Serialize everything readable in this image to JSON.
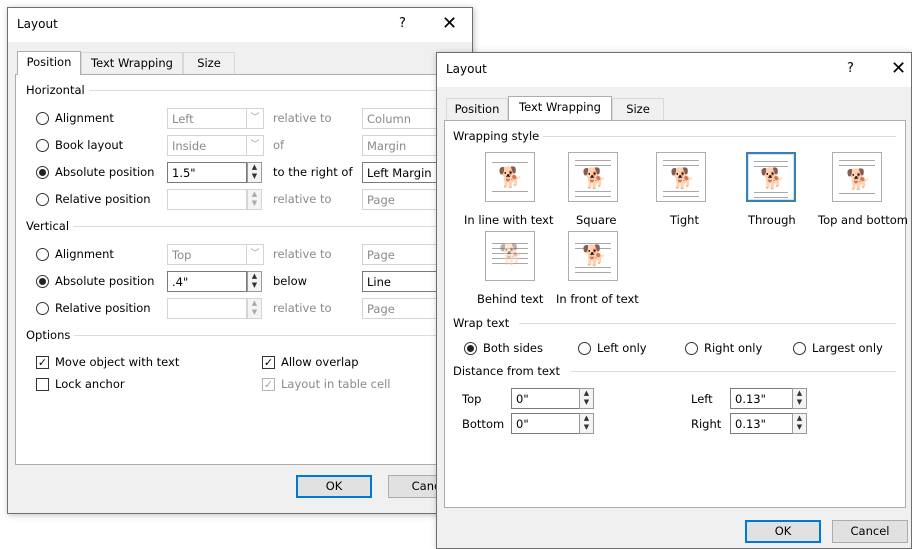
{
  "back_dialog": {
    "title": "Layout",
    "help": "?",
    "close": "✕",
    "tabs": [
      "Position",
      "Text Wrapping",
      "Size"
    ],
    "horizontal": {
      "label": "Horizontal",
      "rows": [
        {
          "label": "Alignment",
          "value": "Left",
          "rel": "relative to",
          "target": "Column"
        },
        {
          "label": "Book layout",
          "value": "Inside",
          "rel": "of",
          "target": "Margin"
        },
        {
          "label": "Absolute position",
          "value": "1.5\"",
          "rel": "to the right of",
          "target": "Left Margin"
        },
        {
          "label": "Relative position",
          "value": "",
          "rel": "relative to",
          "target": "Page"
        }
      ]
    },
    "vertical": {
      "label": "Vertical",
      "rows": [
        {
          "label": "Alignment",
          "value": "Top",
          "rel": "relative to",
          "target": "Page"
        },
        {
          "label": "Absolute position",
          "value": ".4\"",
          "rel": "below",
          "target": "Line"
        },
        {
          "label": "Relative position",
          "value": "",
          "rel": "relative to",
          "target": "Page"
        }
      ]
    },
    "options": {
      "label": "Options",
      "move_with_text": "Move object with text",
      "lock_anchor": "Lock anchor",
      "allow_overlap": "Allow overlap",
      "layout_in_cell": "Layout in table cell"
    },
    "ok": "OK",
    "cancel": "Canc"
  },
  "front_dialog": {
    "title": "Layout",
    "help": "?",
    "close": "✕",
    "tabs": [
      "Position",
      "Text Wrapping",
      "Size"
    ],
    "wrapping_style": {
      "label": "Wrapping style",
      "options": [
        "In line with text",
        "Square",
        "Tight",
        "Through",
        "Top and bottom",
        "Behind text",
        "In front of text"
      ],
      "selected": "Through"
    },
    "wrap_text": {
      "label": "Wrap text",
      "options": [
        "Both sides",
        "Left only",
        "Right only",
        "Largest only"
      ],
      "selected": "Both sides"
    },
    "distance": {
      "label": "Distance from text",
      "top_label": "Top",
      "top": "0\"",
      "bottom_label": "Bottom",
      "bottom": "0\"",
      "left_label": "Left",
      "left": "0.13\"",
      "right_label": "Right",
      "right": "0.13\""
    },
    "ok": "OK",
    "cancel": "Cancel"
  }
}
